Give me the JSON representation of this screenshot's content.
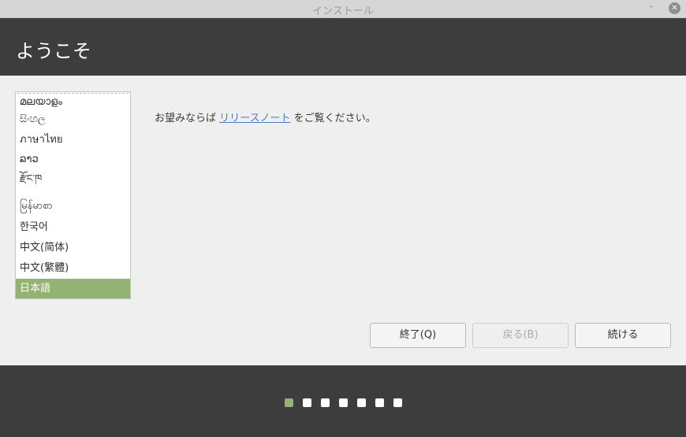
{
  "window": {
    "title": "インストール",
    "minimize_glyph": "-",
    "close_glyph": "✕"
  },
  "header": {
    "heading": "ようこそ"
  },
  "language_list": {
    "items": [
      {
        "label": "മലയാളം",
        "selected": false
      },
      {
        "label": "සිංහල",
        "selected": false
      },
      {
        "label": "ภาษาไทย",
        "selected": false
      },
      {
        "label": "ລາວ",
        "selected": false
      },
      {
        "label": "རྫོང་ཁ",
        "selected": false
      },
      {
        "label": "မြန်မာစာ",
        "selected": false
      },
      {
        "label": "한국어",
        "selected": false
      },
      {
        "label": "中文(简体)",
        "selected": false
      },
      {
        "label": "中文(繁體)",
        "selected": false
      },
      {
        "label": "日本語",
        "selected": true
      }
    ]
  },
  "release_notes": {
    "prefix": "お望みならば ",
    "link": "リリースノート",
    "suffix": " をご覧ください。"
  },
  "buttons": {
    "quit": "終了(Q)",
    "back": "戻る(B)",
    "continue": "続ける"
  },
  "progress": {
    "total_steps": 7,
    "current_step": 1
  },
  "colors": {
    "accent": "#92b372",
    "header_bg": "#3d3d3d",
    "link": "#4a7fc1"
  }
}
